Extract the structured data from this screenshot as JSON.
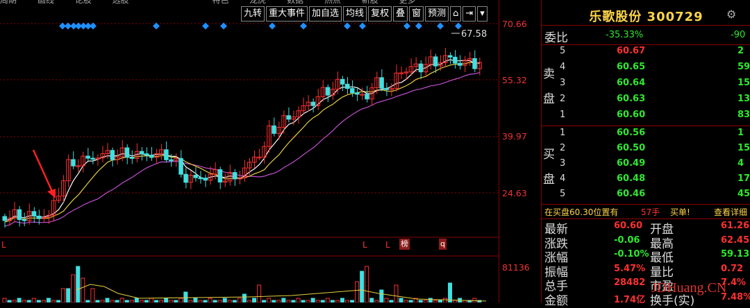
{
  "top_menu": [
    "周期",
    "画线",
    "论股",
    "选股",
    "",
    "",
    "",
    "特色",
    "龙虎",
    "数据",
    "热点",
    "新股",
    "更多"
  ],
  "toolbar": [
    "九转",
    "重大事件",
    "加自选",
    "均线",
    "复权",
    "叠",
    "窗",
    "预测",
    "",
    "",
    ""
  ],
  "toolbar_icons": [
    "lock-icon",
    "exit-icon",
    "dropdown-icon"
  ],
  "price_axis": [
    "70.66",
    "55.32",
    "39.97",
    "24.63"
  ],
  "vol_axis": [
    "81136"
  ],
  "peak_label": "67.58",
  "markers": {
    "L1": "L",
    "L2": "L",
    "L3": "L",
    "bang": "榜",
    "q": "q"
  },
  "stock": {
    "name_code": "乐歌股份 300729"
  },
  "weibi": {
    "label": "委比",
    "pct": "-35.33%",
    "diff": "-90"
  },
  "sell_side_label": [
    "卖",
    "盘"
  ],
  "buy_side_label": [
    "买",
    "盘"
  ],
  "sell_orders": [
    {
      "level": "5",
      "price": "60.67",
      "vol": "2"
    },
    {
      "level": "4",
      "price": "60.65",
      "vol": "59"
    },
    {
      "level": "3",
      "price": "60.64",
      "vol": "15"
    },
    {
      "level": "2",
      "price": "60.63",
      "vol": "13"
    },
    {
      "level": "1",
      "price": "60.60",
      "vol": "83"
    }
  ],
  "buy_orders": [
    {
      "level": "1",
      "price": "60.56",
      "vol": "1"
    },
    {
      "level": "2",
      "price": "60.50",
      "vol": "15"
    },
    {
      "level": "3",
      "price": "60.49",
      "vol": "4"
    },
    {
      "level": "4",
      "price": "60.48",
      "vol": "17"
    },
    {
      "level": "5",
      "price": "60.46",
      "vol": "45"
    }
  ],
  "alert": {
    "text": "在买盘60.30位置有",
    "qty": "57手",
    "action": "买单!",
    "detail": "查看详细"
  },
  "quote_rows": [
    {
      "l1": "最新",
      "v1": "60.60",
      "l2": "开盘",
      "v2": "61.26"
    },
    {
      "l1": "涨跌",
      "v1": "-0.06",
      "l2": "最高",
      "v2": "62.45"
    },
    {
      "l1": "涨幅",
      "v1": "-0.10%",
      "l2": "最低",
      "v2": "59.13"
    },
    {
      "l1": "振幅",
      "v1": "5.47%",
      "l2": "量比",
      "v2": "0.72"
    },
    {
      "l1": "总手",
      "v1": "28482",
      "l2": "市盈",
      "v2": "7.4%"
    },
    {
      "l1": "金额",
      "v1": "1.74亿",
      "l2": "换手(实)",
      "v2": "7.48%"
    }
  ],
  "watermark": "JDHuang.CN",
  "colors": {
    "up": "#ff3030",
    "down": "#40e0e0",
    "ma5": "#ffffff",
    "ma10": "#e8d040",
    "ma20": "#c050d0",
    "diamond": "#1e90ff",
    "grid": "#8b0000"
  }
}
